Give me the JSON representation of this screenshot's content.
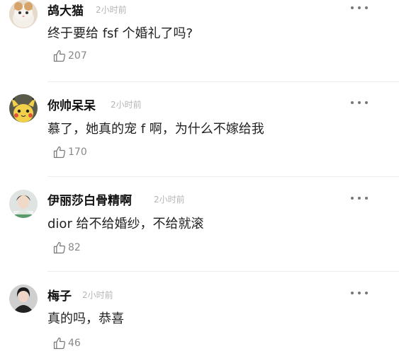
{
  "comments": [
    {
      "username": "鸪大猫",
      "time": "2小时前",
      "text": "终于要给 fsf 个婚礼了吗?",
      "likes": "207",
      "avatar": "cat-avatar"
    },
    {
      "username": "你帅呆呆",
      "time": "2小时前",
      "text": "慕了，她真的宠 f 啊，为什么不嫁给我",
      "likes": "170",
      "avatar": "pikachu-avatar"
    },
    {
      "username": "伊丽莎白骨精啊",
      "time": "2小时前",
      "text": "dior 给不给婚纱，不给就滚",
      "likes": "82",
      "avatar": "person-avatar"
    },
    {
      "username": "梅子",
      "time": "2小时前",
      "text": "真的吗，恭喜",
      "likes": "46",
      "avatar": "person-dark-avatar"
    }
  ],
  "colors": {
    "username": "#111111",
    "timestamp": "#b5b5b5",
    "text": "#222222",
    "likes": "#888888",
    "divider": "#ececec"
  },
  "icons": [
    "thumbs-up-icon",
    "more-dots-icon"
  ]
}
